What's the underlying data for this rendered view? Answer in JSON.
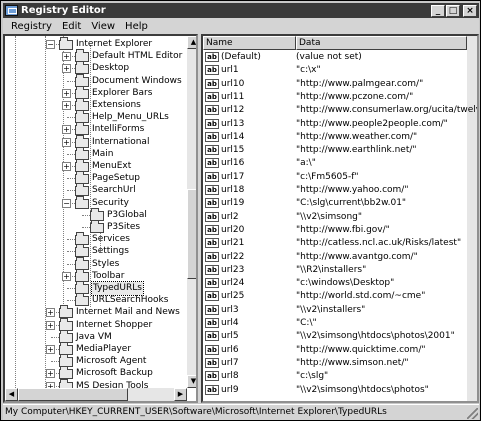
{
  "window": {
    "title": "Registry Editor",
    "buttons": [
      "_",
      "□",
      "×"
    ]
  },
  "menubar": {
    "items": [
      "Registry",
      "Edit",
      "View",
      "Help"
    ]
  },
  "tree": {
    "items": [
      {
        "label": "Internet Explorer",
        "expander": "−"
      },
      {
        "label": "Default HTML Editor",
        "expander": "+"
      },
      {
        "label": "Desktop",
        "expander": "+"
      },
      {
        "label": "Document Windows",
        "expander": ""
      },
      {
        "label": "Explorer Bars",
        "expander": "+"
      },
      {
        "label": "Extensions",
        "expander": "+"
      },
      {
        "label": "Help_Menu_URLs",
        "expander": ""
      },
      {
        "label": "IntelliForms",
        "expander": "+"
      },
      {
        "label": "International",
        "expander": "+"
      },
      {
        "label": "Main",
        "expander": ""
      },
      {
        "label": "MenuExt",
        "expander": "+"
      },
      {
        "label": "PageSetup",
        "expander": ""
      },
      {
        "label": "SearchUrl",
        "expander": ""
      },
      {
        "label": "Security",
        "expander": "−"
      },
      {
        "label": "P3Global",
        "expander": ""
      },
      {
        "label": "P3Sites",
        "expander": ""
      },
      {
        "label": "Services",
        "expander": ""
      },
      {
        "label": "Settings",
        "expander": ""
      },
      {
        "label": "Styles",
        "expander": ""
      },
      {
        "label": "Toolbar",
        "expander": "+"
      },
      {
        "label": "TypedURLs",
        "expander": ""
      },
      {
        "label": "URLSearchHooks",
        "expander": ""
      },
      {
        "label": "Internet Mail and News",
        "expander": "+"
      },
      {
        "label": "Internet Shopper",
        "expander": "+"
      },
      {
        "label": "Java VM",
        "expander": ""
      },
      {
        "label": "MediaPlayer",
        "expander": "+"
      },
      {
        "label": "Microsoft Agent",
        "expander": ""
      },
      {
        "label": "Microsoft Backup",
        "expander": "+"
      },
      {
        "label": "MS Design Tools",
        "expander": "+"
      }
    ]
  },
  "list": {
    "headers": {
      "name": "Name",
      "data": "Data"
    },
    "rows": [
      {
        "name": "(Default)",
        "data": "(value not set)"
      },
      {
        "name": "url1",
        "data": "\"c:\\x\""
      },
      {
        "name": "url10",
        "data": "\"http://www.palmgear.com/\""
      },
      {
        "name": "url11",
        "data": "\"http://www.pczone.com/\""
      },
      {
        "name": "url12",
        "data": "\"http://www.consumerlaw.org/ucita/twelve_prob"
      },
      {
        "name": "url13",
        "data": "\"http://www.people2people.com/\""
      },
      {
        "name": "url14",
        "data": "\"http://www.weather.com/\""
      },
      {
        "name": "url15",
        "data": "\"http://www.earthlink.net/\""
      },
      {
        "name": "url16",
        "data": "\"a:\\\""
      },
      {
        "name": "url17",
        "data": "\"c:\\Fm5605-f\""
      },
      {
        "name": "url18",
        "data": "\"http://www.yahoo.com/\""
      },
      {
        "name": "url19",
        "data": "\"C:\\slg\\current\\bb2w.01\""
      },
      {
        "name": "url2",
        "data": "\"\\\\v2\\simsong\""
      },
      {
        "name": "url20",
        "data": "\"http://www.fbi.gov/\""
      },
      {
        "name": "url21",
        "data": "\"http://catless.ncl.ac.uk/Risks/latest\""
      },
      {
        "name": "url22",
        "data": "\"http://www.avantgo.com/\""
      },
      {
        "name": "url23",
        "data": "\"\\\\R2\\installers\""
      },
      {
        "name": "url24",
        "data": "\"c:\\windows\\Desktop\""
      },
      {
        "name": "url25",
        "data": "\"http://world.std.com/~cme\""
      },
      {
        "name": "url3",
        "data": "\"\\\\v2\\installers\""
      },
      {
        "name": "url4",
        "data": "\"C:\\\""
      },
      {
        "name": "url5",
        "data": "\"\\\\v2\\simsong\\htdocs\\photos\\2001\""
      },
      {
        "name": "url6",
        "data": "\"http://www.quicktime.com/\""
      },
      {
        "name": "url7",
        "data": "\"http://www.simson.net/\""
      },
      {
        "name": "url8",
        "data": "\"c:\\slg\""
      },
      {
        "name": "url9",
        "data": "\"\\\\v2\\simsong\\htdocs\\photos\""
      }
    ]
  },
  "status": {
    "path": "My Computer\\HKEY_CURRENT_USER\\Software\\Microsoft\\Internet Explorer\\TypedURLs"
  }
}
